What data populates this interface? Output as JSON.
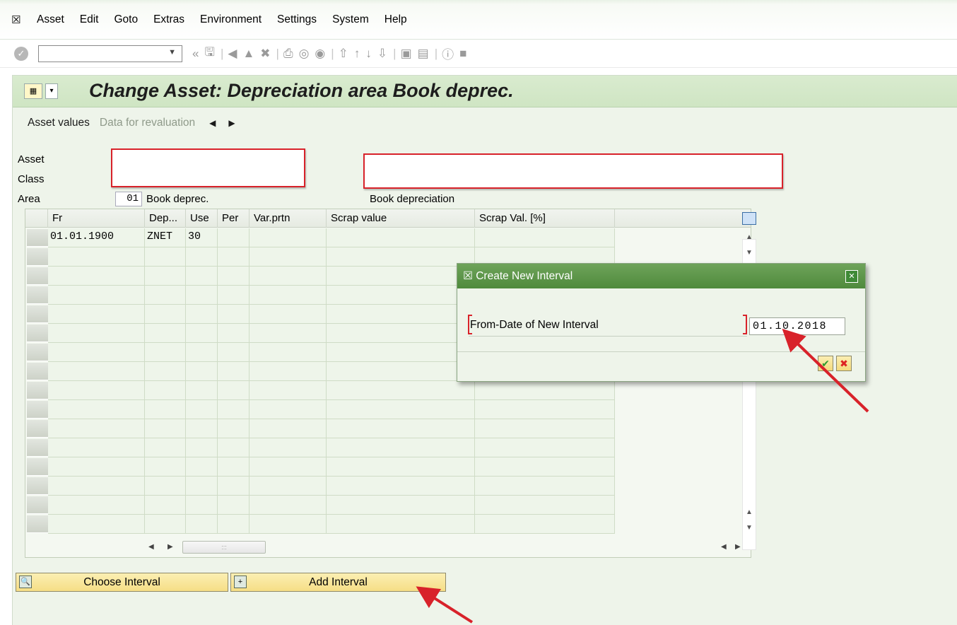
{
  "menubar": {
    "items": [
      "Asset",
      "Edit",
      "Goto",
      "Extras",
      "Environment",
      "Settings",
      "System",
      "Help"
    ]
  },
  "toolbar": {
    "command_value": ""
  },
  "title": "Change Asset: Depreciation area Book deprec.",
  "appbar": {
    "asset_values": "Asset values",
    "data_for_revaluation": "Data for revaluation"
  },
  "header": {
    "asset_label": "Asset",
    "class_label": "Class",
    "area_label": "Area",
    "area_code": "01",
    "area_name": "Book deprec.",
    "area_description": "Book depreciation"
  },
  "table": {
    "columns": [
      "Fr",
      "Dep...",
      "Use",
      "Per",
      "Var.prtn",
      "Scrap value",
      "Scrap Val. [%]"
    ],
    "rows": [
      [
        "01.01.1900",
        "ZNET",
        "30",
        "",
        "",
        "",
        ""
      ]
    ]
  },
  "buttons": {
    "choose_interval": "Choose Interval",
    "add_interval": "Add Interval"
  },
  "dialog": {
    "title": "Create New Interval",
    "field_label": "From-Date of New Interval",
    "field_value": "01.10.2018"
  },
  "colors": {
    "title_bg": "#cfe5c3",
    "dialog_title_bg": "#4f8a3c",
    "button_bg": "#f6de86",
    "annotation_red": "#d8222a"
  }
}
